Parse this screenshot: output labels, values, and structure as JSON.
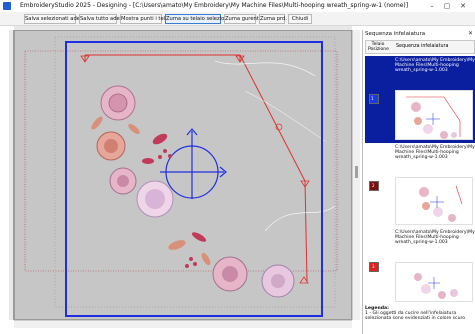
{
  "window": {
    "title": "EmbroideryStudio 2025 - Designing - [C:\\Users\\amato\\My Embroidery\\My Machine Files\\Multi-hooping wreath_spring-w-1    (nome)]",
    "minimize": "–",
    "maximize": "▢",
    "close": "✕"
  },
  "toolbar": {
    "buttons": [
      "Salva selezionati adesso",
      "Salva tutto adesso",
      "Mostra punti i telai",
      "Zuma su telaio selezionato",
      "Zuma gurenti",
      "Zuma prd.",
      "Chiudi"
    ],
    "active_index": 3
  },
  "side_panel": {
    "title": "Sequenza infelaiatura",
    "close": "✕",
    "col_hoop": "Telaio Posizione",
    "col_seq": "Sequenza infelaiatura",
    "rows": [
      {
        "number": "1",
        "path": "C:\\Users\\amato\\My Embroidery\\My Machine Files\\Multi-hooping wreath_spring-w-1.003"
      },
      {
        "number": "2",
        "path": "C:\\Users\\amato\\My Embroidery\\My Machine Files\\Multi-hooping wreath_spring-w-1.003"
      },
      {
        "number": "3",
        "path": "C:\\Users\\amato\\My Embroidery\\My Machine Files\\Multi-hooping wreath_spring-w-1.003"
      }
    ],
    "legend_title": "Legenda:",
    "legend_text": "1 - Gli oggetti da cucire nell'infelaiatura selezionata sono evidenziati in colore scuro"
  },
  "colors": {
    "hoop_blue": "#1f2fe0",
    "selected_row": "#0a1fa0",
    "row2_swatch": "#7a1010",
    "row3_swatch": "#e02020",
    "guide_red": "#e03030"
  }
}
